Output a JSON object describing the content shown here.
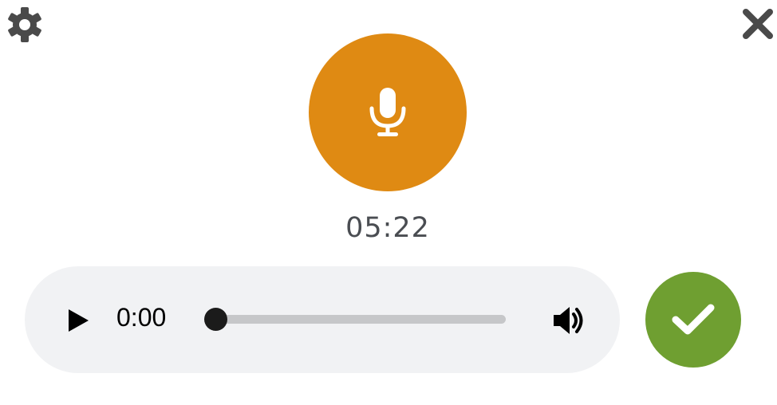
{
  "toolbar": {
    "settings_icon": "gear-icon",
    "close_icon": "close-icon"
  },
  "recorder": {
    "record_icon": "microphone-icon",
    "elapsed": "05:22",
    "accent_color": "#df8a13"
  },
  "player": {
    "play_icon": "play-icon",
    "current_time": "0:00",
    "progress": 0,
    "volume_icon": "volume-icon",
    "background_color": "#f1f2f4"
  },
  "confirm": {
    "icon": "check-icon",
    "color": "#6f9f31"
  }
}
